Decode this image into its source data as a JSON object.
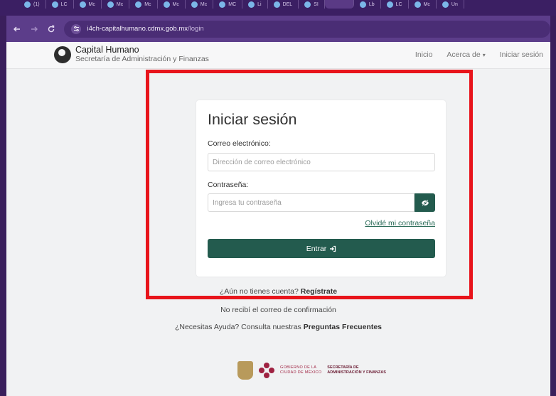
{
  "browser": {
    "tabs": [
      "(1)",
      "LC",
      "Mc",
      "Mc",
      "Mc",
      "Mc",
      "Mc",
      "MC",
      "Li",
      "DEL",
      "SI",
      "Lb",
      "LC",
      "Mc",
      "Un"
    ],
    "url_host": "i4ch-capitalhumano.cdmx.gob.mx",
    "url_path": "/login"
  },
  "header": {
    "brand_title": "Capital Humano",
    "brand_subtitle": "Secretaría de Administración y Finanzas",
    "nav": {
      "home": "Inicio",
      "about": "Acerca de",
      "login": "Iniciar sesión"
    }
  },
  "login": {
    "title": "Iniciar sesión",
    "email_label": "Correo electrónico:",
    "email_placeholder": "Dirección de correo electrónico",
    "password_label": "Contraseña:",
    "password_placeholder": "Ingresa tu contraseña",
    "forgot_link": "Olvidé mi contraseña",
    "submit_label": "Entrar"
  },
  "below": {
    "register_prompt": "¿Aún no tienes cuenta?",
    "register_link": "Regístrate",
    "confirm_email": "No recibí el correo de confirmación",
    "help_prompt": "¿Necesitas Ayuda? Consulta nuestras",
    "faq_link": "Preguntas Frecuentes"
  },
  "footer": {
    "gob_line1": "GOBIERNO DE LA",
    "gob_line2": "CIUDAD DE MÉXICO",
    "sec_line1": "SECRETARÍA DE",
    "sec_line2": "ADMINISTRACIÓN Y FINANZAS"
  },
  "colors": {
    "primary": "#235b4e",
    "highlight": "#e8141b",
    "browser_chrome": "#5c3d8a"
  }
}
